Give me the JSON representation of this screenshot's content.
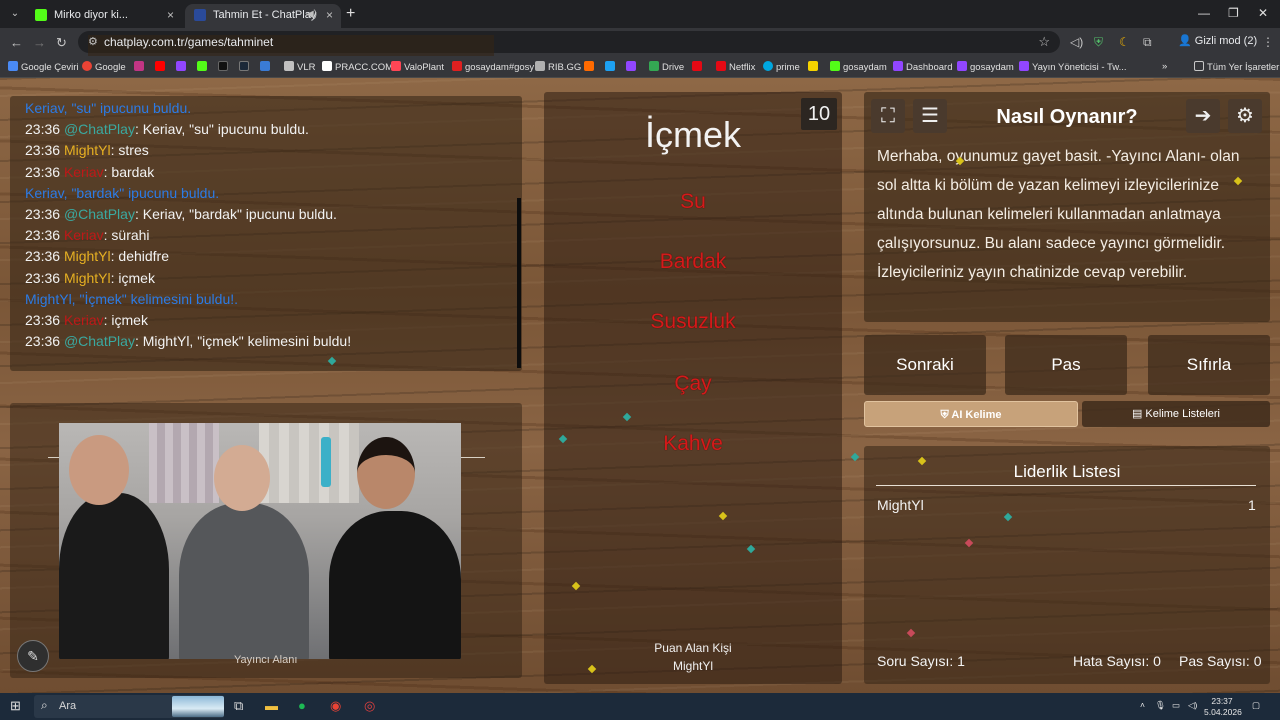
{
  "browser": {
    "tabs": [
      {
        "title": "Mirko diyor ki...",
        "close": "×"
      },
      {
        "title": "Tahmin Et - ChatPlay",
        "close": "×"
      }
    ],
    "new_tab": "+",
    "url": "chatplay.com.tr/games/tahminet",
    "profile": "Gizli mod (2)",
    "bookmarks": [
      "Google Çeviri",
      "Google",
      "",
      "",
      "",
      "",
      "",
      "",
      "VLR",
      "PRACC.COM",
      "ValoPlant",
      "gosaydam#gosy",
      "RIB.GG",
      "",
      "",
      "",
      "Drive",
      "",
      "Netflix",
      "prime",
      "",
      "gosaydam",
      "Dashboard",
      "gosaydam",
      "Yayın Yöneticisi - Tw...",
      "Tüm Yer İşaretleri"
    ],
    "bookmark_colors": [
      "#4a8af4",
      "#ea4335",
      "#c13584",
      "#ff0000",
      "#9146ff",
      "#53fc18",
      "#111111",
      "#1b2838",
      "#3a7bd5",
      "#c0c0c0",
      "#ffffff",
      "#ff4655",
      "#e02020",
      "#b0b0b0",
      "#ff6a00",
      "#1da1f2",
      "#9146ff",
      "#34a853",
      "#e50914",
      "#e50914",
      "#00a8e1",
      "#f5d300",
      "#53fc18",
      "#9146ff",
      "#9146ff",
      "#9146ff",
      "#9aa0a6"
    ]
  },
  "chat": {
    "lines": [
      {
        "time": "",
        "user": "Keriav, ",
        "userClass": "cyan",
        "body": "\"su\" ipucunu buldu.",
        "bodyClass": "cyan",
        "sep": ""
      },
      {
        "time": "23:36",
        "user": "@ChatPlay",
        "userClass": "chatp",
        "body": "Keriav, \"su\" ipucunu buldu.",
        "bodyClass": "",
        "sep": ": "
      },
      {
        "time": "23:36",
        "user": "MightYl",
        "userClass": "gold",
        "body": "stres",
        "bodyClass": "",
        "sep": ": "
      },
      {
        "time": "23:36",
        "user": "Keriav",
        "userClass": "redn",
        "body": "bardak",
        "bodyClass": "",
        "sep": ": "
      },
      {
        "time": "",
        "user": "Keriav, ",
        "userClass": "cyan",
        "body": "\"bardak\" ipucunu buldu.",
        "bodyClass": "cyan",
        "sep": ""
      },
      {
        "time": "23:36",
        "user": "@ChatPlay",
        "userClass": "chatp",
        "body": "Keriav, \"bardak\" ipucunu buldu.",
        "bodyClass": "",
        "sep": ": "
      },
      {
        "time": "23:36",
        "user": "Keriav",
        "userClass": "redn",
        "body": "sürahi",
        "bodyClass": "",
        "sep": ": "
      },
      {
        "time": "23:36",
        "user": "MightYl",
        "userClass": "gold",
        "body": "dehidfre",
        "bodyClass": "",
        "sep": ": "
      },
      {
        "time": "23:36",
        "user": "MightYl",
        "userClass": "gold",
        "body": "içmek",
        "bodyClass": "",
        "sep": ": "
      },
      {
        "time": "",
        "user": "MightYl, ",
        "userClass": "cyan",
        "body": "\"İçmek\" kelimesini buldu!.",
        "bodyClass": "cyan",
        "sep": ""
      },
      {
        "time": "23:36",
        "user": "Keriav",
        "userClass": "redn",
        "body": "içmek",
        "bodyClass": "",
        "sep": ": "
      },
      {
        "time": "23:36",
        "user": "@ChatPlay",
        "userClass": "chatp",
        "body": "MightYl, \"içmek\" kelimesini buldu!",
        "bodyClass": "",
        "sep": ": "
      }
    ]
  },
  "streamer": {
    "label": "Yayıncı Alanı"
  },
  "game": {
    "counter": "10",
    "word": "İçmek",
    "taboo": [
      "Su",
      "Bardak",
      "Susuzluk",
      "Çay",
      "Kahve"
    ],
    "scorer_label": "Puan Alan Kişi",
    "scorer": "MightYl"
  },
  "info": {
    "title": "Nasıl Oynanır?",
    "text": "Merhaba, oyunumuz gayet basit. -Yayıncı Alanı- olan sol altta ki bölüm de yazan kelimeyi izleyicilerinize altında bulunan kelimeleri kullanmadan anlatmaya çalışıyorsunuz. Bu alanı sadece yayıncı görmelidir. İzleyicileriniz yayın chatinizde cevap verebilir."
  },
  "controls": {
    "next": "Sonraki",
    "pass": "Pas",
    "reset": "Sıfırla",
    "ai": "AI Kelime",
    "lists": "Kelime Listeleri"
  },
  "leaderboard": {
    "title": "Liderlik Listesi",
    "rows": [
      {
        "name": "MightYl",
        "score": "1"
      }
    ],
    "questions_label": "Soru Sayısı:",
    "questions": "1",
    "errors_label": "Hata Sayısı:",
    "errors": "0",
    "passes_label": "Pas Sayısı:",
    "passes": "0"
  },
  "taskbar": {
    "search": "Ara",
    "time": "23:37",
    "date": "5.04.2026"
  },
  "colors": {
    "accent": "#c7a27a",
    "taboo": "#d41a1a",
    "chat_notice": "#2c7be5"
  }
}
